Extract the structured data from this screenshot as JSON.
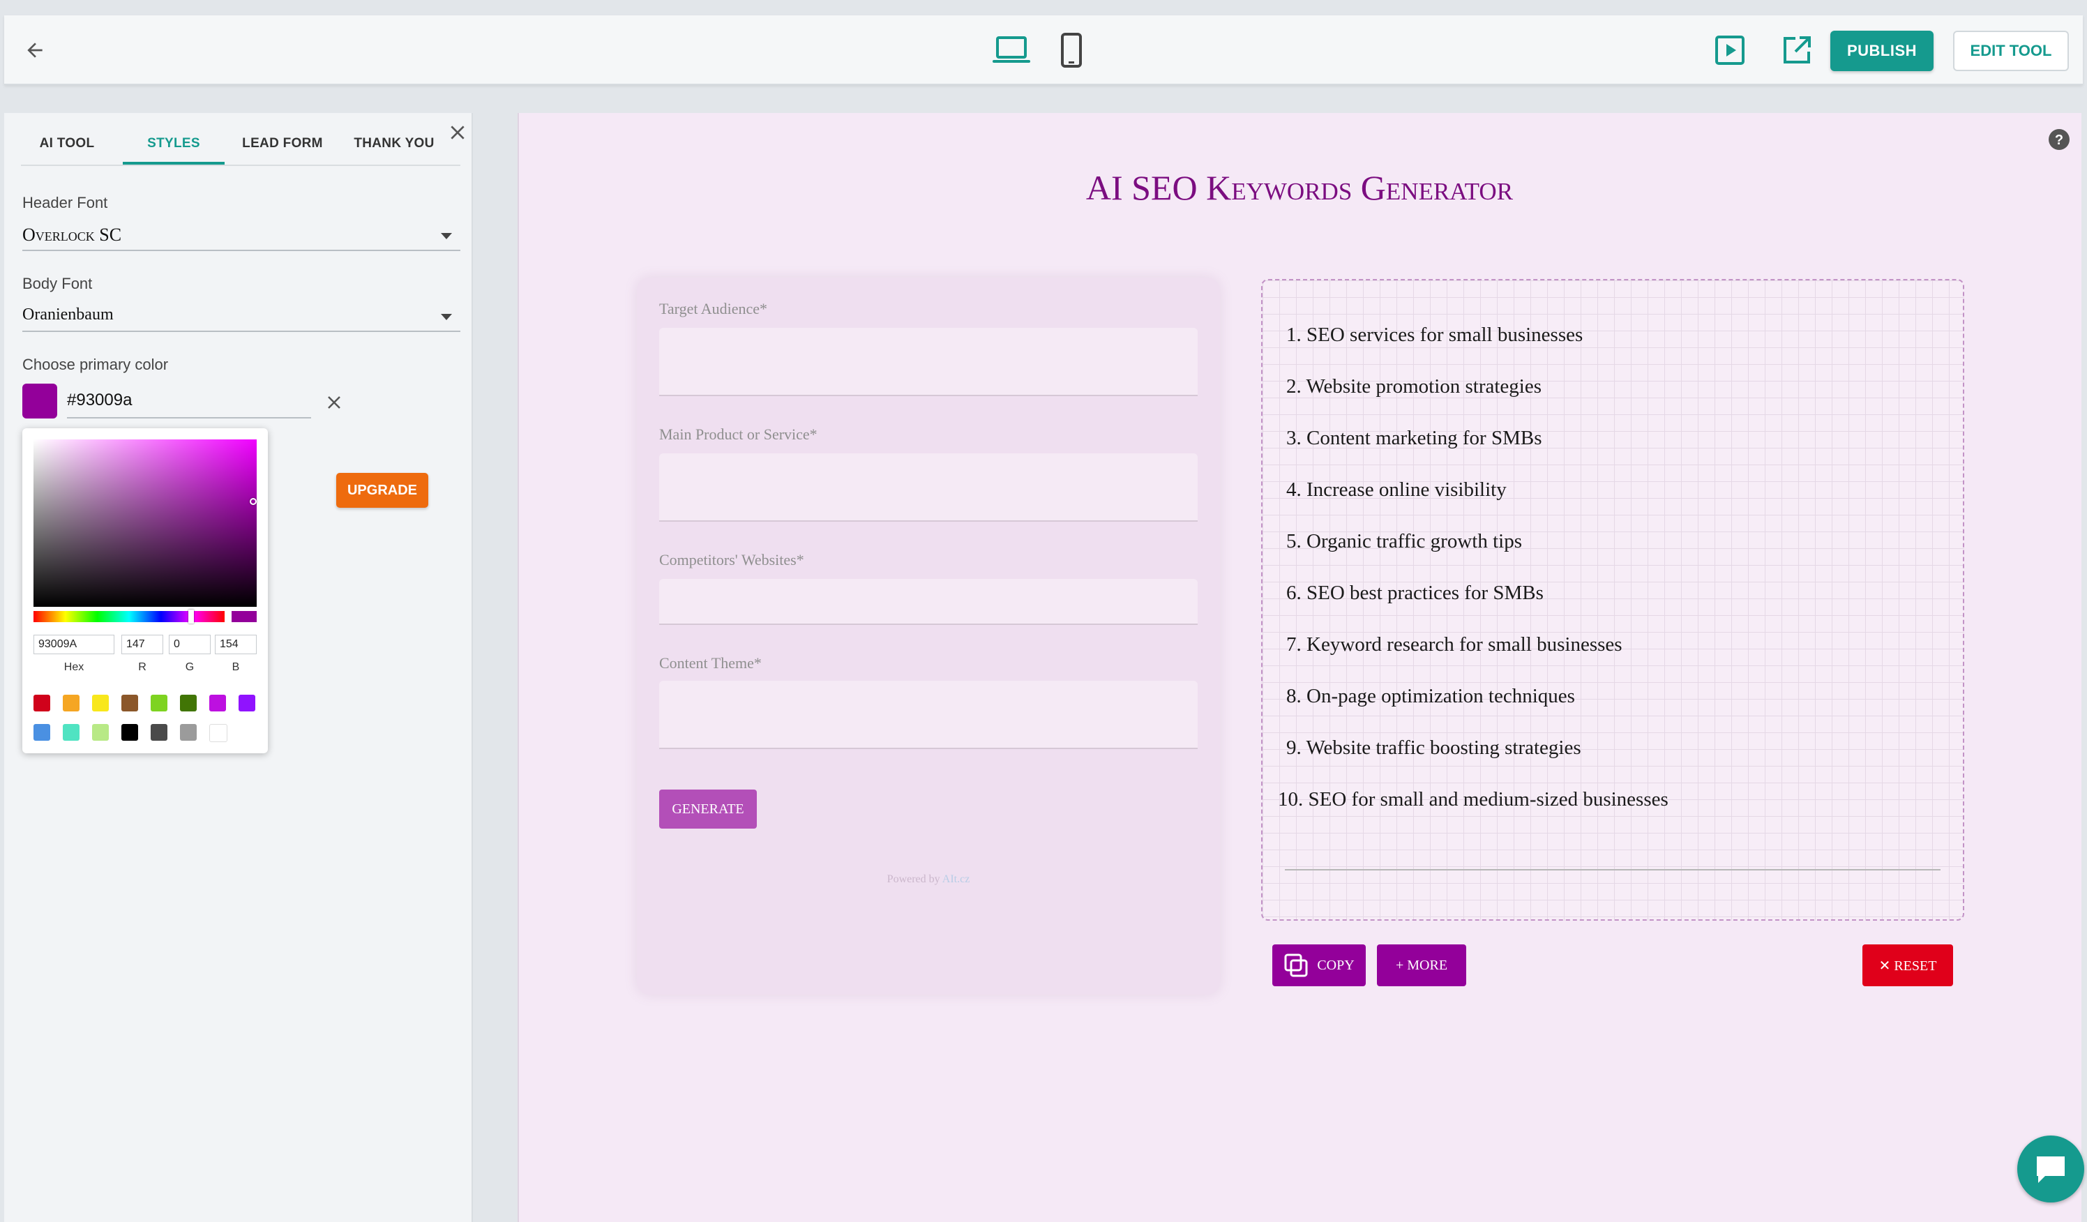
{
  "toolbar": {
    "back_icon": "arrow-left-icon",
    "desktop_icon": "laptop-icon",
    "mobile_icon": "smartphone-icon",
    "preview_icon": "play-square-icon",
    "open_external_icon": "external-link-icon",
    "publish_label": "PUBLISH",
    "edit_label": "EDIT TOOL"
  },
  "sidebar": {
    "tabs": [
      {
        "label": "AI TOOL"
      },
      {
        "label": "STYLES",
        "active": true
      },
      {
        "label": "LEAD FORM"
      },
      {
        "label": "THANK YOU"
      }
    ],
    "header_font": {
      "label": "Header Font",
      "value": "Overlock SC"
    },
    "body_font": {
      "label": "Body Font",
      "value": "Oranienbaum"
    },
    "primary_color": {
      "label": "Choose primary color",
      "value": "#93009a",
      "swatch": "#93009a"
    },
    "upgrade_label": "UPGRADE"
  },
  "picker": {
    "hex": "93009A",
    "r": "147",
    "g": "0",
    "b": "154",
    "hex_label": "Hex",
    "r_label": "R",
    "g_label": "G",
    "b_label": "B",
    "presets": [
      "#d0021b",
      "#f5a623",
      "#f8e71c",
      "#8b572a",
      "#7ed321",
      "#417505",
      "#bd10e0",
      "#9013fe",
      "#4a90e2",
      "#50e3c2",
      "#b8e986",
      "#000000",
      "#4a4a4a",
      "#9b9b9b",
      "#ffffff"
    ]
  },
  "preview": {
    "title": "AI SEO Keywords Generator",
    "help_icon": "question-circle-icon",
    "fields": [
      {
        "label": "Target Audience*"
      },
      {
        "label": "Main Product or Service*"
      },
      {
        "label": "Competitors' Websites*"
      },
      {
        "label": "Content Theme*"
      }
    ],
    "generate_label": "GENERATE",
    "powered_by": "Powered by",
    "powered_brand": "AIt.cz",
    "results": [
      "1. SEO services for small businesses",
      "2. Website promotion strategies",
      "3. Content marketing for SMBs",
      "4. Increase online visibility",
      "5. Organic traffic growth tips",
      "6. SEO best practices for SMBs",
      "7. Keyword research for small businesses",
      "8. On-page optimization techniques",
      "9. Website traffic boosting strategies",
      "10. SEO for small and medium-sized businesses"
    ],
    "copy_label": "COPY",
    "more_label": "+ MORE",
    "reset_label": "✕ RESET",
    "chat_icon": "chat-bubble-icon"
  },
  "colors": {
    "primary": "#93009a",
    "teal": "#159a8e",
    "upgrade": "#ee6b0e",
    "reset": "#e0001a"
  }
}
